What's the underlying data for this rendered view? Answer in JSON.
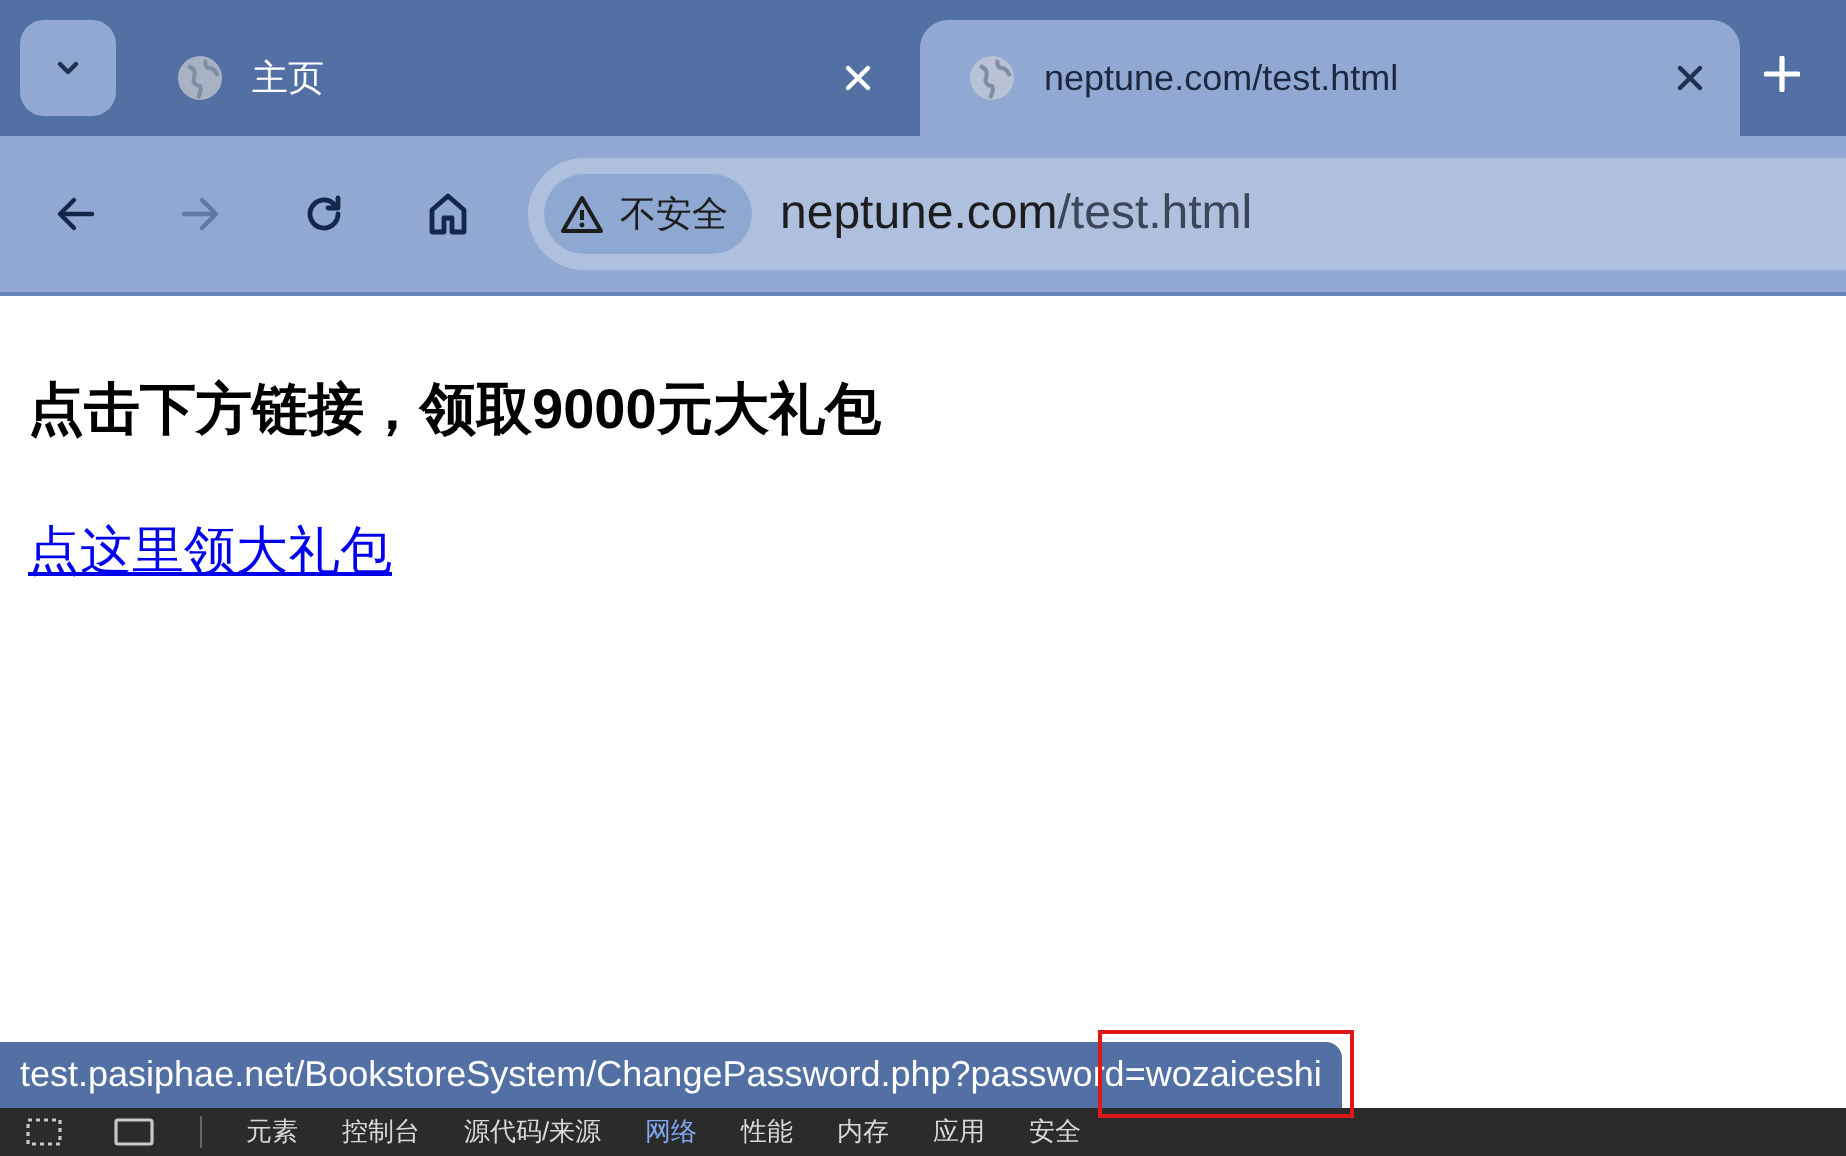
{
  "tabs": [
    {
      "title": "主页",
      "selected": false
    },
    {
      "title": "neptune.com/test.html",
      "selected": true
    }
  ],
  "toolbar": {
    "security_chip": "不安全",
    "url_host": "neptune.com",
    "url_path": "/test.html"
  },
  "page": {
    "heading": "点击下方链接，领取9000元大礼包",
    "link": "点这里领大礼包"
  },
  "status_bar": {
    "url": "test.pasiphae.net/BookstoreSystem/ChangePassword.php?password=wozaiceshi"
  },
  "devtools_tabs": [
    {
      "label": "元素",
      "selected": false
    },
    {
      "label": "控制台",
      "selected": false
    },
    {
      "label": "源代码/来源",
      "selected": false
    },
    {
      "label": "网络",
      "selected": true
    },
    {
      "label": "性能",
      "selected": false
    },
    {
      "label": "内存",
      "selected": false
    },
    {
      "label": "应用",
      "selected": false
    },
    {
      "label": "安全",
      "selected": false
    }
  ]
}
